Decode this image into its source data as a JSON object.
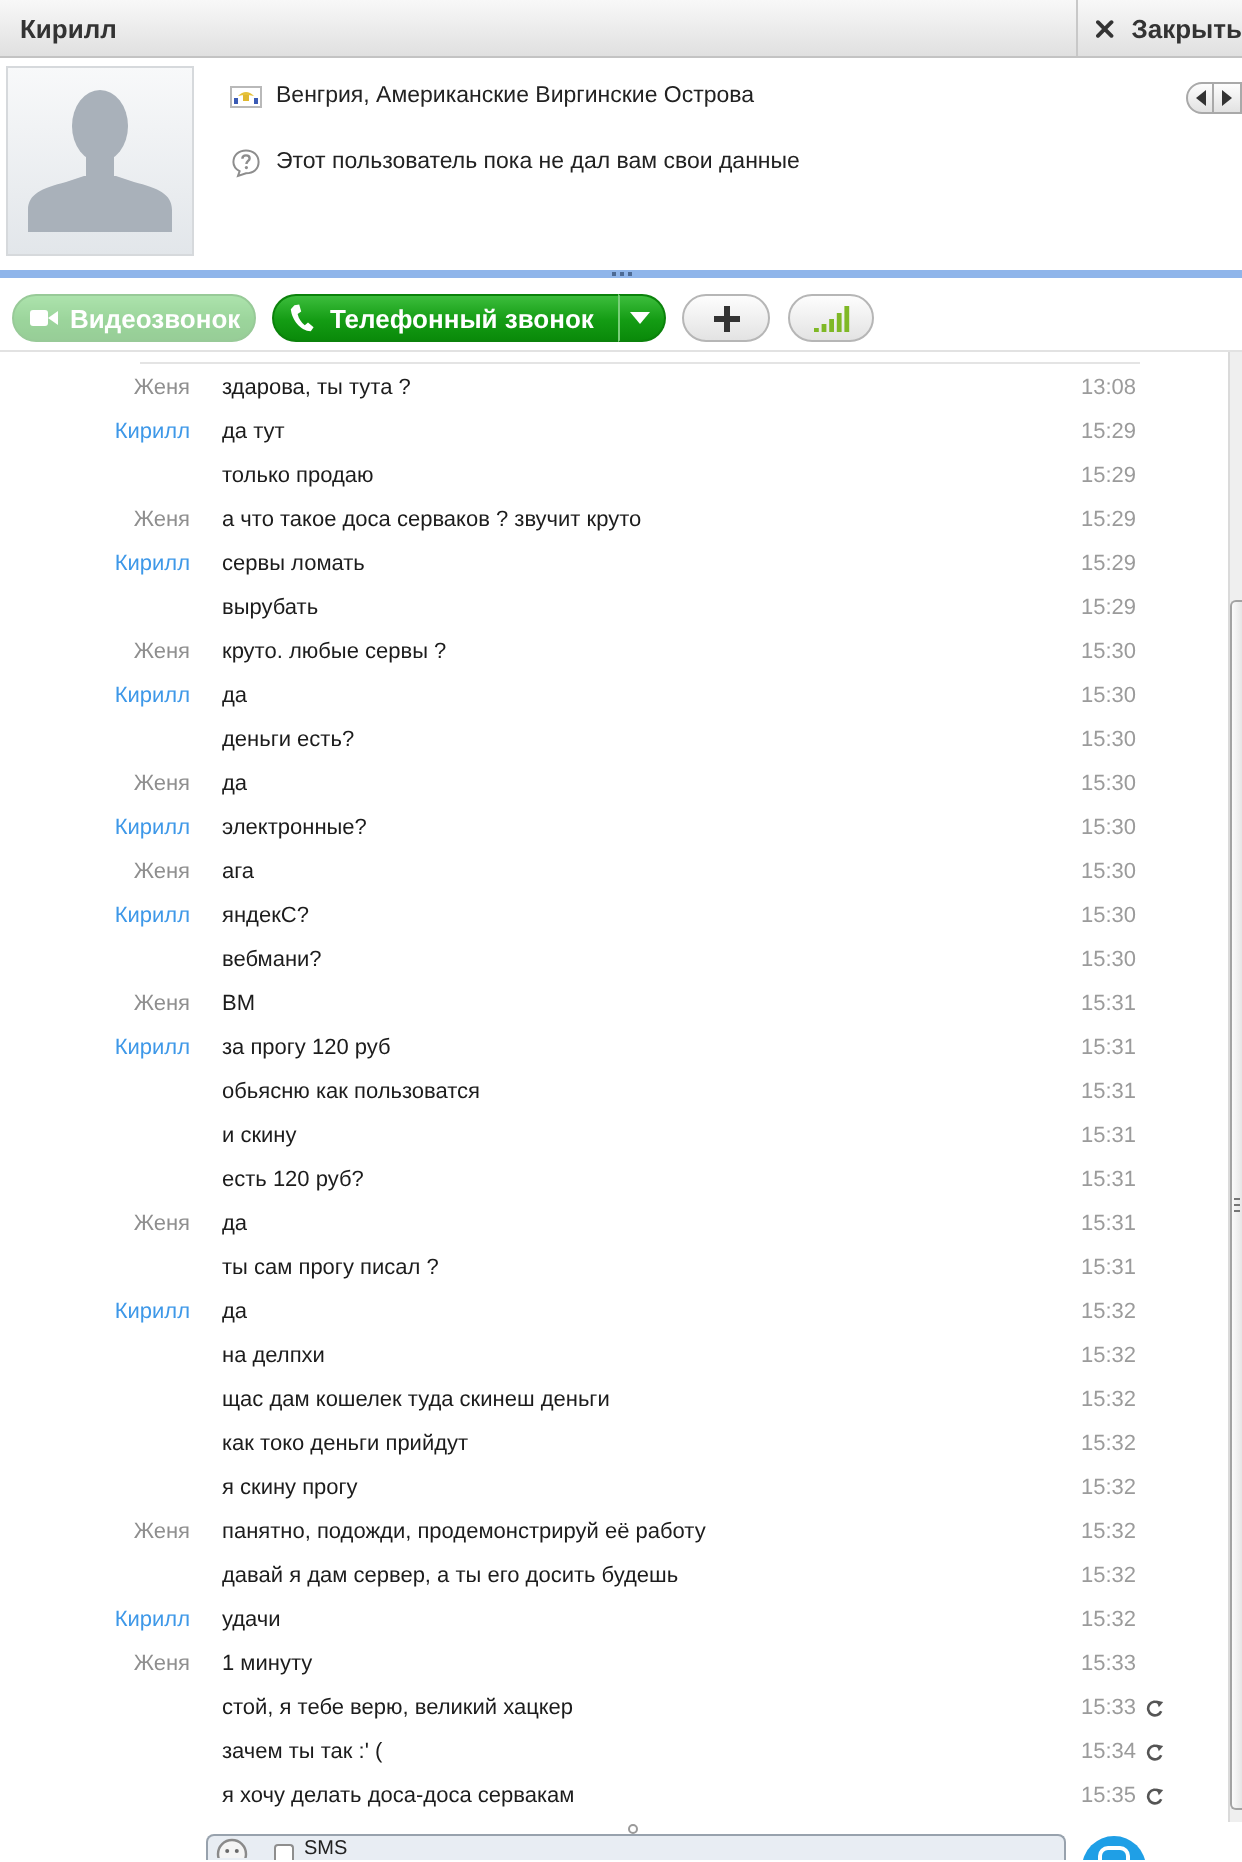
{
  "title_bar": {
    "contact_name": "Кирилл",
    "close_label": "Закрыть"
  },
  "profile": {
    "location": "Венгрия, Американские Виргинские Острова",
    "notice": "Этот пользователь пока не дал вам свои данные"
  },
  "toolbar": [
    {
      "kind": "video",
      "label": "Видеозвонок",
      "disabled": true
    },
    {
      "kind": "call",
      "label": "Телефонный звонок",
      "disabled": false
    },
    {
      "kind": "add",
      "disabled": false
    },
    {
      "kind": "quality",
      "disabled": false
    }
  ],
  "messages": [
    {
      "sender": {
        "name": "Женя",
        "color": "#8f8f8f"
      },
      "text": "здарова, ты тута ?",
      "time": "13:08",
      "pending": false
    },
    {
      "sender": {
        "name": "Кирилл",
        "color": "#3e98e8"
      },
      "text": "да тут",
      "time": "15:29",
      "pending": false
    },
    {
      "text": "только продаю",
      "time": "15:29",
      "pending": false
    },
    {
      "sender": {
        "name": "Женя",
        "color": "#8f8f8f"
      },
      "text": "а что такое доса серваков ? звучит круто",
      "time": "15:29",
      "pending": false
    },
    {
      "sender": {
        "name": "Кирилл",
        "color": "#3e98e8"
      },
      "text": "сервы ломать",
      "time": "15:29",
      "pending": false
    },
    {
      "text": "вырубать",
      "time": "15:29",
      "pending": false
    },
    {
      "sender": {
        "name": "Женя",
        "color": "#8f8f8f"
      },
      "text": "круто. любые сервы ?",
      "time": "15:30",
      "pending": false
    },
    {
      "sender": {
        "name": "Кирилл",
        "color": "#3e98e8"
      },
      "text": "да",
      "time": "15:30",
      "pending": false
    },
    {
      "text": "деньги есть?",
      "time": "15:30",
      "pending": false
    },
    {
      "sender": {
        "name": "Женя",
        "color": "#8f8f8f"
      },
      "text": "да",
      "time": "15:30",
      "pending": false
    },
    {
      "sender": {
        "name": "Кирилл",
        "color": "#3e98e8"
      },
      "text": "электронные?",
      "time": "15:30",
      "pending": false
    },
    {
      "sender": {
        "name": "Женя",
        "color": "#8f8f8f"
      },
      "text": "ага",
      "time": "15:30",
      "pending": false
    },
    {
      "sender": {
        "name": "Кирилл",
        "color": "#3e98e8"
      },
      "text": "яндекС?",
      "time": "15:30",
      "pending": false
    },
    {
      "text": "вебмани?",
      "time": "15:30",
      "pending": false
    },
    {
      "sender": {
        "name": "Женя",
        "color": "#8f8f8f"
      },
      "text": "ВМ",
      "time": "15:31",
      "pending": false
    },
    {
      "sender": {
        "name": "Кирилл",
        "color": "#3e98e8"
      },
      "text": "за прогу 120 руб",
      "time": "15:31",
      "pending": false
    },
    {
      "text": "обьясню как пользоватся",
      "time": "15:31",
      "pending": false
    },
    {
      "text": "и скину",
      "time": "15:31",
      "pending": false
    },
    {
      "text": "есть 120 руб?",
      "time": "15:31",
      "pending": false
    },
    {
      "sender": {
        "name": "Женя",
        "color": "#8f8f8f"
      },
      "text": "да",
      "time": "15:31",
      "pending": false
    },
    {
      "text": "ты сам прогу писал ?",
      "time": "15:31",
      "pending": false
    },
    {
      "sender": {
        "name": "Кирилл",
        "color": "#3e98e8"
      },
      "text": "да",
      "time": "15:32",
      "pending": false
    },
    {
      "text": "на делпхи",
      "time": "15:32",
      "pending": false
    },
    {
      "text": "щас дам кошелек туда скинеш деньги",
      "time": "15:32",
      "pending": false
    },
    {
      "text": "как токо деньги прийдут",
      "time": "15:32",
      "pending": false
    },
    {
      "text": "я скину прогу",
      "time": "15:32",
      "pending": false
    },
    {
      "sender": {
        "name": "Женя",
        "color": "#8f8f8f"
      },
      "text": "панятно, подожди, продемонстрируй её работу",
      "time": "15:32",
      "pending": false
    },
    {
      "text": "давай я дам сервер, а ты его досить будешь",
      "time": "15:32",
      "pending": false
    },
    {
      "sender": {
        "name": "Кирилл",
        "color": "#3e98e8"
      },
      "text": "удачи",
      "time": "15:32",
      "pending": false
    },
    {
      "sender": {
        "name": "Женя",
        "color": "#8f8f8f"
      },
      "text": "1 минуту",
      "time": "15:33",
      "pending": false
    },
    {
      "text": "стой, я тебе верю, великий хацкер",
      "time": "15:33",
      "pending": true
    },
    {
      "text": "зачем ты так :' (",
      "time": "15:34",
      "pending": true
    },
    {
      "text": "я хочу делать доса-доса сервакам",
      "time": "15:35",
      "pending": true
    }
  ],
  "composer": {
    "sms": {
      "label": "SMS",
      "checked": false
    }
  }
}
